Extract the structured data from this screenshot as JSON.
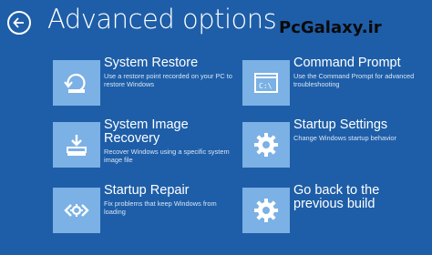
{
  "header": {
    "title": "Advanced options",
    "watermark": "PcGalaxy.ir"
  },
  "tiles": [
    {
      "title": "System Restore",
      "description": "Use a restore point recorded on your PC to restore Windows",
      "icon": "system-restore-icon"
    },
    {
      "title": "Command Prompt",
      "description": "Use the Command Prompt for advanced troubleshooting",
      "icon": "command-prompt-icon"
    },
    {
      "title": "System Image Recovery",
      "description": "Recover Windows using a specific system image file",
      "icon": "system-image-recovery-icon"
    },
    {
      "title": "Startup Settings",
      "description": "Change Windows startup behavior",
      "icon": "gear-icon"
    },
    {
      "title": "Startup Repair",
      "description": "Fix problems that keep Windows from loading",
      "icon": "startup-repair-icon"
    },
    {
      "title": "Go back to the previous build",
      "description": "",
      "icon": "gear-icon"
    }
  ],
  "colors": {
    "background": "#1e5ea8",
    "tile_icon_bg": "#7bb1e4",
    "text": "#ffffff"
  }
}
